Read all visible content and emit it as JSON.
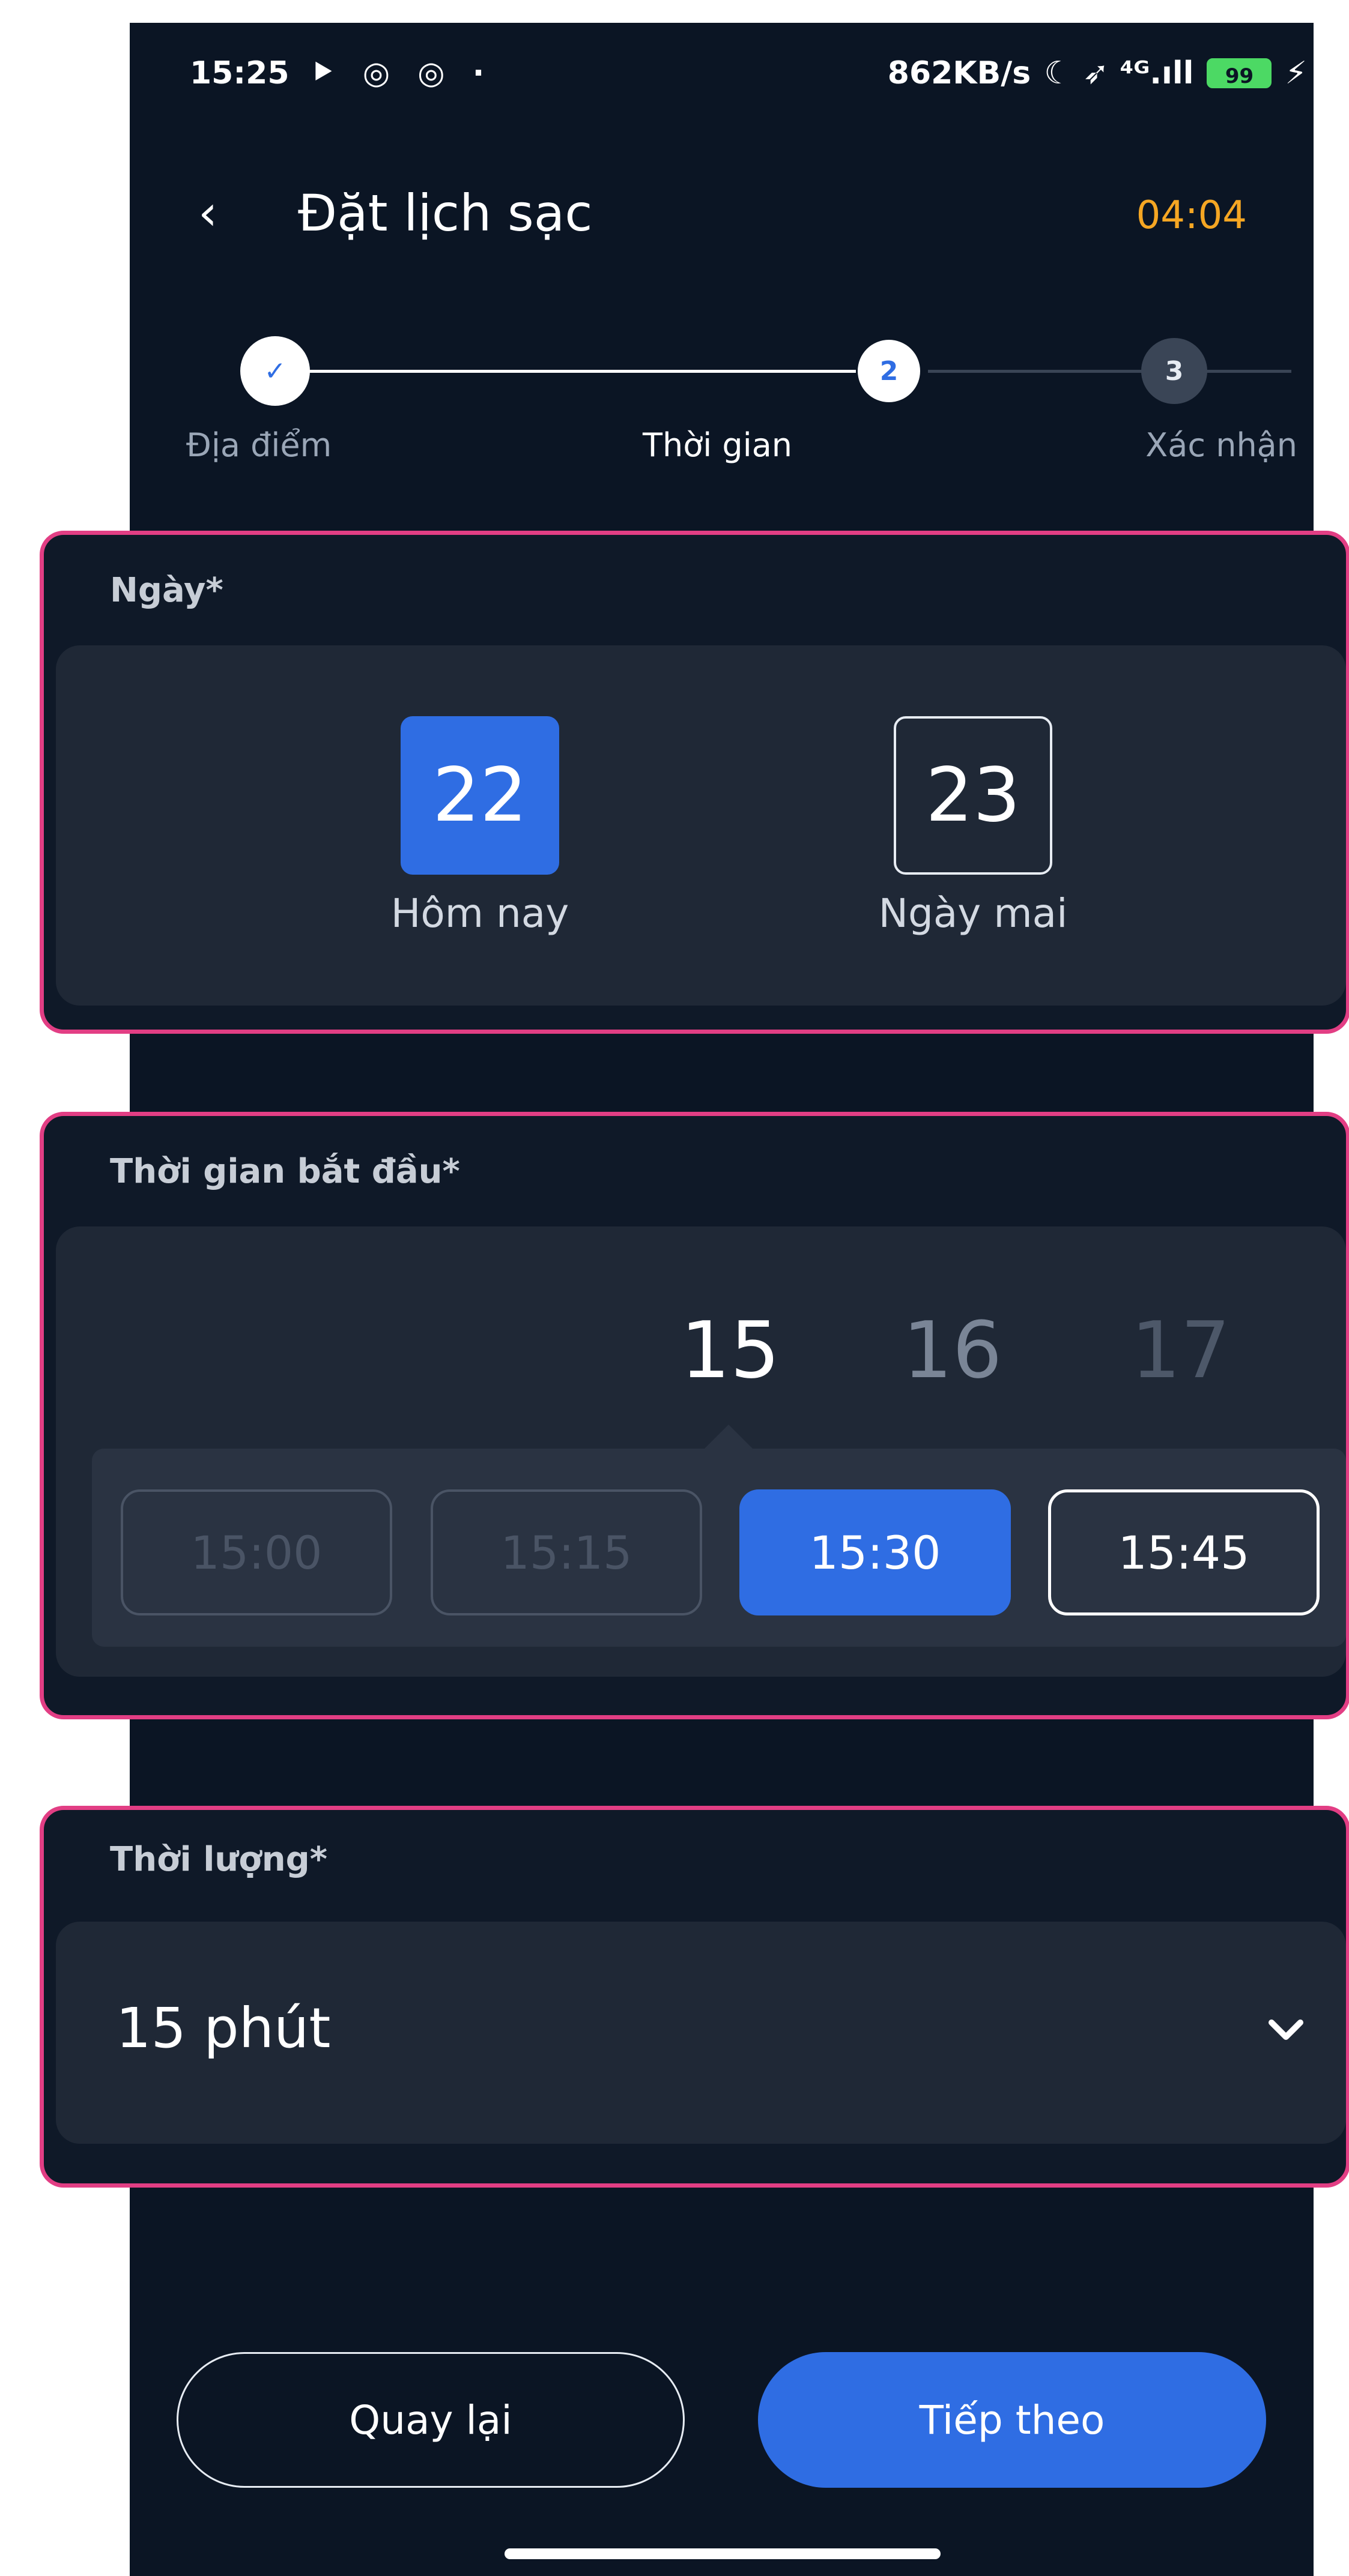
{
  "status_bar": {
    "time": "15:25",
    "icons_left": "⯈ ◎ ◎ ·",
    "speed": "862KB/s",
    "icons_right": "☾ ➶ ⁴ᴳ.ıll",
    "battery": "99"
  },
  "header": {
    "title": "Đặt lịch sạc",
    "back_icon": "‹",
    "timer": "04:04",
    "timer_color": "#f5a623"
  },
  "stepper": {
    "steps": [
      {
        "number": "✓",
        "label": "Địa điểm"
      },
      {
        "number": "2",
        "label": "Thời gian"
      },
      {
        "number": "3",
        "label": "Xác nhận"
      }
    ]
  },
  "date_section": {
    "label": "Ngày*",
    "dates": [
      {
        "day": "22",
        "caption": "Hôm nay",
        "selected": true
      },
      {
        "day": "23",
        "caption": "Ngày mai",
        "selected": false
      }
    ]
  },
  "start_time_section": {
    "label": "Thời gian bắt đầu*",
    "hours": [
      "15",
      "16",
      "17"
    ],
    "slots": [
      {
        "time": "15:00",
        "state": "disabled"
      },
      {
        "time": "15:15",
        "state": "disabled"
      },
      {
        "time": "15:30",
        "state": "selected"
      },
      {
        "time": "15:45",
        "state": "available"
      }
    ]
  },
  "duration_section": {
    "label": "Thời lượng*",
    "value": "15 phút"
  },
  "buttons": {
    "back": "Quay lại",
    "next": "Tiếp theo"
  },
  "colors": {
    "accent": "#2f6de3",
    "highlight_border": "#e23e84",
    "background": "#0b1524"
  }
}
